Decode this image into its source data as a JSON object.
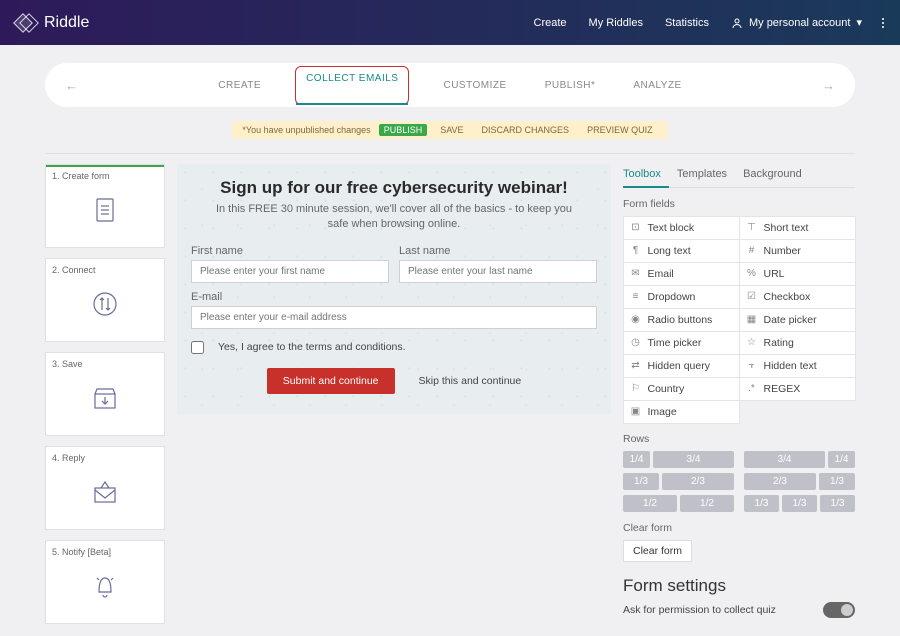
{
  "brand": "Riddle",
  "nav": {
    "create": "Create",
    "my_riddles": "My Riddles",
    "statistics": "Statistics",
    "account": "My personal account"
  },
  "steps": {
    "create": "CREATE",
    "collect": "COLLECT EMAILS",
    "customize": "CUSTOMIZE",
    "publish": "PUBLISH*",
    "analyze": "ANALYZE"
  },
  "unpub": {
    "msg": "*You have unpublished changes",
    "publish": "PUBLISH",
    "save": "SAVE",
    "discard": "DISCARD CHANGES",
    "preview": "PREVIEW QUIZ"
  },
  "left": {
    "create_form": "1. Create form",
    "connect": "2. Connect",
    "save": "3. Save",
    "reply": "4. Reply",
    "notify": "5. Notify [Beta]"
  },
  "form": {
    "title": "Sign up for our free cybersecurity webinar!",
    "subtitle": "In this FREE 30 minute session, we'll cover all of the basics - to keep you safe when browsing online.",
    "first_name_label": "First name",
    "first_name_ph": "Please enter your first name",
    "last_name_label": "Last name",
    "last_name_ph": "Please enter your last name",
    "email_label": "E-mail",
    "email_ph": "Please enter your e-mail address",
    "terms": "Yes, I agree to the terms and conditions.",
    "submit": "Submit and continue",
    "skip": "Skip this and continue"
  },
  "right": {
    "tabs": {
      "toolbox": "Toolbox",
      "templates": "Templates",
      "background": "Background"
    },
    "form_fields_label": "Form fields",
    "fields": {
      "text_block": "Text block",
      "short_text": "Short text",
      "long_text": "Long text",
      "number": "Number",
      "email": "Email",
      "url": "URL",
      "dropdown": "Dropdown",
      "checkbox": "Checkbox",
      "radio": "Radio buttons",
      "date": "Date picker",
      "time": "Time picker",
      "rating": "Rating",
      "hidden_query": "Hidden query",
      "hidden_text": "Hidden text",
      "country": "Country",
      "regex": "REGEX",
      "image": "Image"
    },
    "rows_label": "Rows",
    "rows": {
      "r1a": "1/4",
      "r1b": "3/4",
      "r1c": "3/4",
      "r1d": "1/4",
      "r2a": "1/3",
      "r2b": "2/3",
      "r2c": "2/3",
      "r2d": "1/3",
      "r3a": "1/2",
      "r3b": "1/2",
      "r3c": "1/3",
      "r3d": "1/3",
      "r3e": "1/3"
    },
    "clear_label": "Clear form",
    "clear_btn": "Clear form",
    "form_settings": "Form settings",
    "permission": "Ask for permission to collect quiz"
  }
}
